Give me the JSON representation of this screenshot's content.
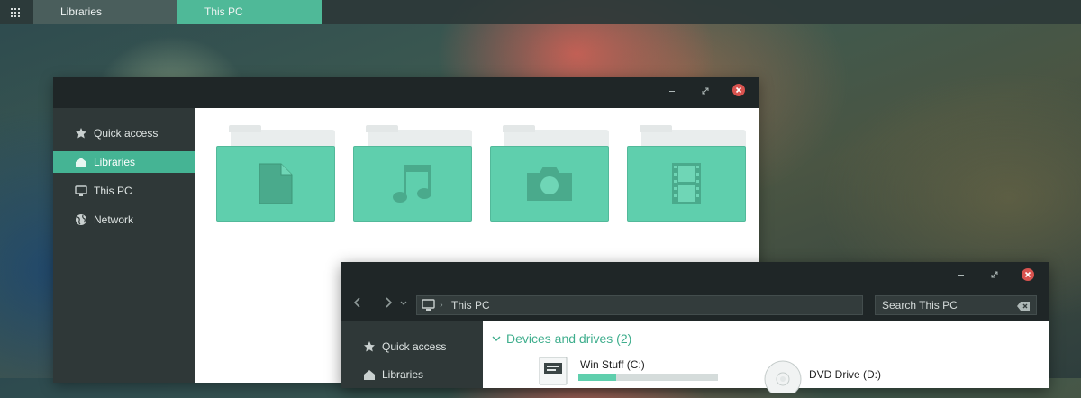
{
  "taskbar": {
    "start_icon": "app-grid-icon",
    "items": [
      {
        "label": "Libraries",
        "active": false
      },
      {
        "label": "This PC",
        "active": true
      }
    ]
  },
  "libraries_window": {
    "controls": {
      "minimize": "minimize-icon",
      "maximize": "maximize-icon",
      "close": "close-icon"
    },
    "nav": [
      {
        "label": "Quick access",
        "icon": "star-icon"
      },
      {
        "label": "Libraries",
        "icon": "home-icon",
        "selected": true
      },
      {
        "label": "This PC",
        "icon": "monitor-icon"
      },
      {
        "label": "Network",
        "icon": "globe-icon"
      }
    ],
    "folders": [
      {
        "icon": "document-icon"
      },
      {
        "icon": "music-icon"
      },
      {
        "icon": "camera-icon"
      },
      {
        "icon": "film-icon"
      }
    ]
  },
  "thispc_window": {
    "address": {
      "location": "This PC"
    },
    "search": {
      "placeholder": "Search This PC"
    },
    "nav": [
      {
        "label": "Quick access",
        "icon": "star-icon"
      },
      {
        "label": "Libraries",
        "icon": "home-icon"
      }
    ],
    "group": {
      "title": "Devices and drives (2)"
    },
    "drives": [
      {
        "name": "Win Stuff (C:)",
        "icon": "hard-drive-icon",
        "used_fraction": 0.27
      },
      {
        "name": "DVD Drive (D:)",
        "icon": "dvd-drive-icon"
      }
    ]
  },
  "colors": {
    "accent": "#45b494",
    "folder": "#5fcfad",
    "dark_chrome": "#1f2627",
    "nav_bg": "#2f3838",
    "close": "#d9534f"
  }
}
